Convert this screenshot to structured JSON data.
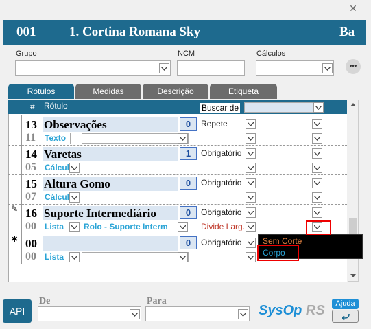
{
  "window": {
    "close_label": "✕"
  },
  "header": {
    "code": "001",
    "title": "1. Cortina Romana Sky",
    "right_text": "Ba"
  },
  "form": {
    "grupo_label": "Grupo",
    "ncm_label": "NCM",
    "calculos_label": "Cálculos",
    "more_label": "•••"
  },
  "tabs": [
    {
      "label": "Rótulos",
      "active": true
    },
    {
      "label": "Medidas",
      "active": false
    },
    {
      "label": "Descrição",
      "active": false
    },
    {
      "label": "Etiqueta",
      "active": false
    }
  ],
  "grid": {
    "col_hash": "#",
    "col_rotulo": "Rótulo",
    "buscar_label": "Buscar de",
    "rows": [
      {
        "num": "13",
        "name": "Observações",
        "sub_num": "11",
        "type": "Texto",
        "extra": "",
        "order": "0",
        "cond": "Repete",
        "cond2": "",
        "marker": ""
      },
      {
        "num": "14",
        "name": "Varetas",
        "sub_num": "05",
        "type": "Cálcul",
        "extra": "",
        "order": "1",
        "cond": "Obrigatório",
        "cond2": "",
        "marker": ""
      },
      {
        "num": "15",
        "name": "Altura Gomo",
        "sub_num": "07",
        "type": "Cálcul",
        "extra": "",
        "order": "0",
        "cond": "Obrigatório",
        "cond2": "",
        "marker": ""
      },
      {
        "num": "16",
        "name": "Suporte Intermediário",
        "sub_num": "00",
        "type": "Lista",
        "extra": "Rolo - Suporte Interm",
        "order": "0",
        "cond": "Obrigatório",
        "cond2": "Divide Larg.",
        "marker": "✎"
      },
      {
        "num": "00",
        "name": "",
        "sub_num": "00",
        "type": "Lista",
        "extra": "",
        "order": "0",
        "cond": "Obrigatório",
        "cond2": "",
        "marker": "✱"
      }
    ]
  },
  "popup": {
    "items": [
      "Sem Corte",
      "Corpo"
    ]
  },
  "footer": {
    "api_label": "API",
    "de_label": "De",
    "para_label": "Para",
    "logo_main": "SysOp",
    "logo_suffix": "RS",
    "help_label": "Ajuda"
  }
}
